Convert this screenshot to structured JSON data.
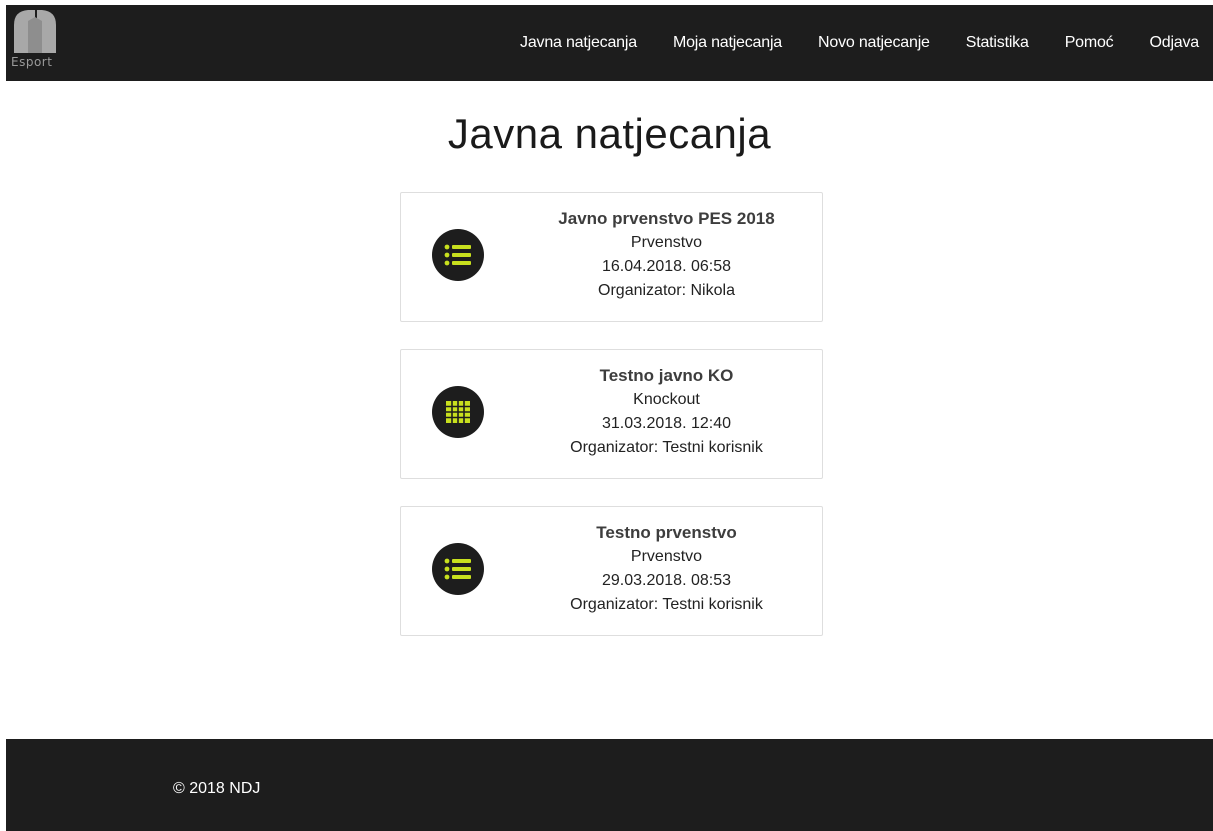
{
  "brand": {
    "logo_text": "Esport"
  },
  "nav": {
    "items": [
      {
        "label": "Javna natjecanja"
      },
      {
        "label": "Moja natjecanja"
      },
      {
        "label": "Novo natjecanje"
      },
      {
        "label": "Statistika"
      },
      {
        "label": "Pomoć"
      },
      {
        "label": "Odjava"
      }
    ]
  },
  "main": {
    "title": "Javna natjecanja",
    "competitions": [
      {
        "name": "Javno prvenstvo PES 2018",
        "type": "Prvenstvo",
        "date": "16.04.2018. 06:58",
        "organizer": "Organizator: Nikola",
        "icon": "list-icon"
      },
      {
        "name": "Testno javno KO",
        "type": "Knockout",
        "date": "31.03.2018. 12:40",
        "organizer": "Organizator: Testni korisnik",
        "icon": "grid-icon"
      },
      {
        "name": "Testno prvenstvo",
        "type": "Prvenstvo",
        "date": "29.03.2018. 08:53",
        "organizer": "Organizator: Testni korisnik",
        "icon": "list-icon"
      }
    ]
  },
  "footer": {
    "copyright": "© 2018 NDJ"
  },
  "colors": {
    "dark": "#1d1d1d",
    "accent": "#c8e01e",
    "border": "#dedede"
  }
}
